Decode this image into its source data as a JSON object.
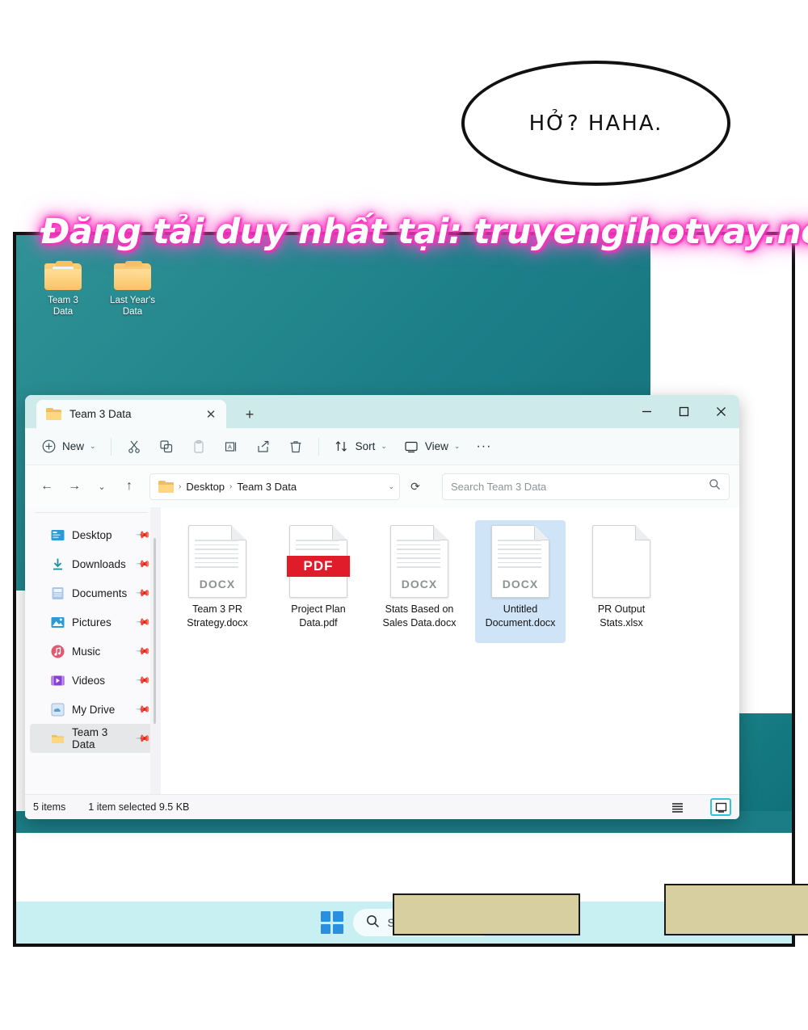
{
  "comic": {
    "speech_bubble_text": "HỞ? HAHA.",
    "watermark_text": "Đăng tải duy nhất tại: truyengihotvay.net",
    "watermark_color": "#ff2fbf"
  },
  "desktop": {
    "wallpaper_color": "#1c7f88",
    "icons": [
      {
        "name": "Team 3 Data",
        "line1": "Team 3",
        "line2": "Data",
        "type": "folder-open"
      },
      {
        "name": "Last Year's Data",
        "line1": "Last Year's",
        "line2": "Data",
        "type": "folder"
      }
    ]
  },
  "taskbar": {
    "start_label": "Start",
    "search_label": "Search",
    "accent_color": "#2b8fe0",
    "background": "#c8eff2"
  },
  "explorer": {
    "tab": {
      "title": "Team 3 Data",
      "close": "✕"
    },
    "new_tab_label": "+",
    "window_controls": {
      "minimize": "Minimize",
      "maximize": "Maximize",
      "close": "Close"
    },
    "toolbar": {
      "new_label": "New",
      "new_plus": "+",
      "cut_label": "Cut",
      "copy_label": "Copy",
      "paste_label": "Paste",
      "rename_label": "Rename",
      "share_label": "Share",
      "delete_label": "Delete",
      "sort_label": "Sort",
      "view_label": "View",
      "more_label": "···"
    },
    "address": {
      "back": "←",
      "forward": "→",
      "recent": "⌄",
      "up": "↑",
      "breadcrumb": [
        "Desktop",
        "Team 3 Data"
      ],
      "separator": "›",
      "dropdown": "⌄",
      "refresh": "⟳"
    },
    "search": {
      "placeholder": "Search Team 3 Data",
      "value": ""
    },
    "sidebar": {
      "items": [
        {
          "label": "Desktop",
          "icon": "desktop-icon",
          "pinned": true,
          "active": false
        },
        {
          "label": "Downloads",
          "icon": "download-icon",
          "pinned": true,
          "active": false
        },
        {
          "label": "Documents",
          "icon": "documents-icon",
          "pinned": true,
          "active": false
        },
        {
          "label": "Pictures",
          "icon": "pictures-icon",
          "pinned": true,
          "active": false
        },
        {
          "label": "Music",
          "icon": "music-icon",
          "pinned": true,
          "active": false
        },
        {
          "label": "Videos",
          "icon": "videos-icon",
          "pinned": true,
          "active": false
        },
        {
          "label": "My Drive",
          "icon": "drive-icon",
          "pinned": true,
          "active": false
        },
        {
          "label": "Team 3 Data",
          "icon": "folder-icon",
          "pinned": true,
          "active": true
        }
      ]
    },
    "files": [
      {
        "name_line1": "Team 3 PR",
        "name_line2": "Strategy.docx",
        "badge": "DOCX",
        "kind": "docx",
        "selected": false
      },
      {
        "name_line1": "Project Plan",
        "name_line2": "Data.pdf",
        "badge": "PDF",
        "kind": "pdf",
        "selected": false
      },
      {
        "name_line1": "Stats Based on",
        "name_line2": "Sales Data.docx",
        "badge": "DOCX",
        "kind": "docx",
        "selected": false
      },
      {
        "name_line1": "Untitled",
        "name_line2": "Document.docx",
        "badge": "DOCX",
        "kind": "docx",
        "selected": true
      },
      {
        "name_line1": "PR Output",
        "name_line2": "Stats.xlsx",
        "badge": "",
        "kind": "xlsx",
        "selected": false
      }
    ],
    "status": {
      "item_count": "5 items",
      "selection": "1 item selected 9.5 KB",
      "details_view_label": "Details view",
      "large_icons_view_label": "Large icons view"
    }
  }
}
